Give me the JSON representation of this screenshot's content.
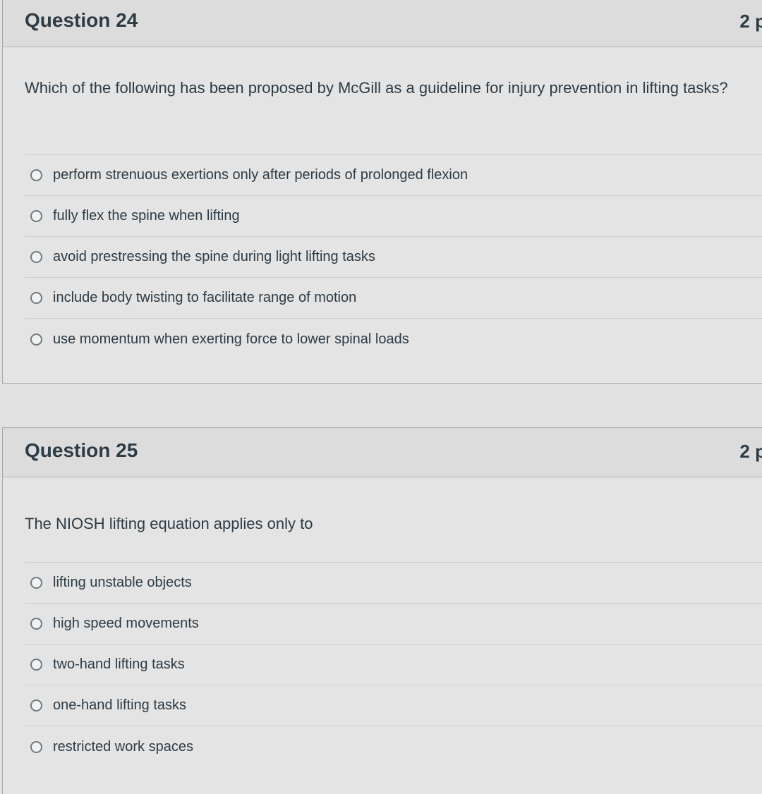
{
  "questions": [
    {
      "title": "Question 24",
      "points": "2 p",
      "text": "Which of the following has been proposed by McGill as a guideline for injury prevention in lifting tasks?",
      "answers": [
        "perform strenuous exertions only after periods of prolonged flexion",
        "fully flex the spine when lifting",
        "avoid prestressing the spine during light lifting tasks",
        "include body twisting to facilitate range of motion",
        "use momentum when exerting force to lower spinal loads"
      ]
    },
    {
      "title": "Question 25",
      "points": "2 p",
      "text": "The NIOSH lifting equation applies only to",
      "answers": [
        "lifting unstable objects",
        "high speed movements",
        "two-hand lifting tasks",
        "one-hand lifting tasks",
        "restricted work spaces"
      ]
    }
  ]
}
